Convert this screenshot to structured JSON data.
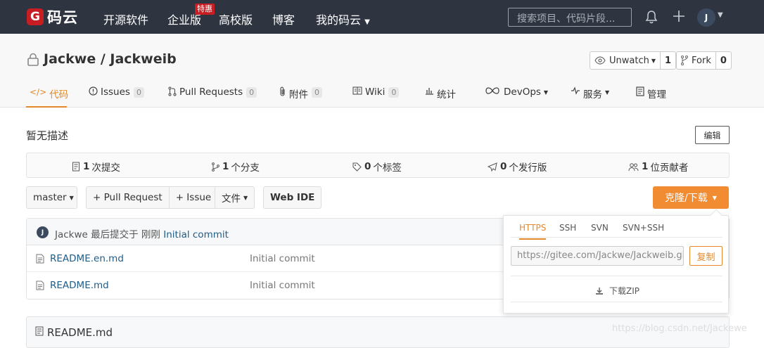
{
  "nav": {
    "logo_glyph": "G",
    "logo_text": "码云",
    "links": [
      "开源软件",
      "企业版",
      "高校版",
      "博客",
      "我的码云"
    ],
    "enterprise_badge": "特惠",
    "search_placeholder": "搜索项目、代码片段...",
    "avatar_initial": "J"
  },
  "repo": {
    "title": "Jackwe / Jackweib",
    "watch_label": "Unwatch",
    "watch_count": "1",
    "fork_label": "Fork",
    "fork_count": "0"
  },
  "tabs": [
    {
      "label": "代码",
      "count": ""
    },
    {
      "label": "Issues",
      "count": "0"
    },
    {
      "label": "Pull Requests",
      "count": "0"
    },
    {
      "label": "附件",
      "count": "0"
    },
    {
      "label": "Wiki",
      "count": "0"
    },
    {
      "label": "统计",
      "count": ""
    },
    {
      "label": "DevOps",
      "count": ""
    },
    {
      "label": "服务",
      "count": ""
    },
    {
      "label": "管理",
      "count": ""
    }
  ],
  "description": "暂无描述",
  "edit_label": "编辑",
  "stats": [
    {
      "count": "1",
      "label": "次提交"
    },
    {
      "count": "1",
      "label": "个分支"
    },
    {
      "count": "0",
      "label": "个标签"
    },
    {
      "count": "0",
      "label": "个发行版"
    },
    {
      "count": "1",
      "label": "位贡献者"
    }
  ],
  "toolbar": {
    "branch": "master",
    "pull_request": "+ Pull Request",
    "issue": "+ Issue",
    "file": "文件",
    "web_ide": "Web IDE",
    "clone": "克隆/下载"
  },
  "commit": {
    "avatar_initial": "J",
    "author_text": "Jackwe 最后提交于 刚刚",
    "message": "Initial commit"
  },
  "files": [
    {
      "name": "README.en.md",
      "message": "Initial commit"
    },
    {
      "name": "README.md",
      "message": "Initial commit"
    }
  ],
  "readme_title": "README.md",
  "clone_panel": {
    "tabs": [
      "HTTPS",
      "SSH",
      "SVN",
      "SVN+SSH"
    ],
    "url": "https://gitee.com/Jackwe/Jackweib.git",
    "copy_label": "复制",
    "zip_label": "下载ZIP"
  },
  "watermark": "https://blog.csdn.net/Jackewe",
  "colors": {
    "accent": "#e4892b",
    "nav_bg": "#2f3441",
    "brand_red": "#c71d23",
    "clone_btn": "#f28c32"
  }
}
